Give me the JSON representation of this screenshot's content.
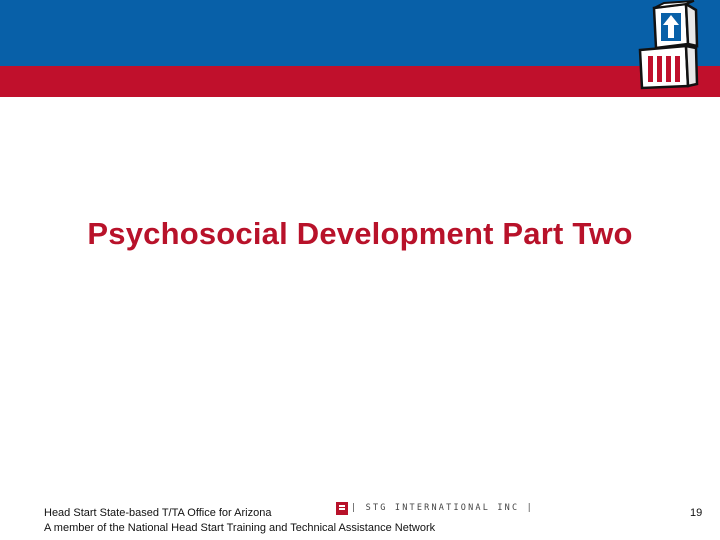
{
  "slide": {
    "title": "Psychosocial Development Part Two",
    "page_number": "19"
  },
  "footer": {
    "line1": "Head Start State-based T/TA Office for Arizona",
    "line2": "A member of the National Head Start Training and Technical Assistance Network",
    "partner_logo_text": "| STG INTERNATIONAL INC |"
  },
  "colors": {
    "header_blue": "#0860a8",
    "header_red": "#c0102c",
    "title_red": "#b8122a"
  },
  "icons": [
    "head-start-blocks-logo-icon",
    "stg-logo-icon"
  ]
}
